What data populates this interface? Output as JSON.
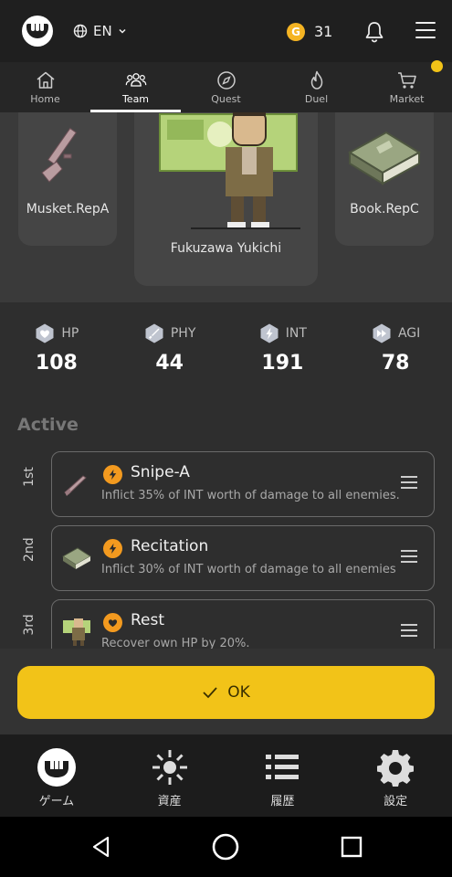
{
  "header": {
    "language": "EN",
    "coins": "31"
  },
  "nav_tabs": [
    {
      "label": "Home",
      "icon": "home-icon"
    },
    {
      "label": "Team",
      "icon": "team-icon",
      "active": true
    },
    {
      "label": "Quest",
      "icon": "compass-icon"
    },
    {
      "label": "Duel",
      "icon": "flame-icon"
    },
    {
      "label": "Market",
      "icon": "cart-icon"
    }
  ],
  "carousel": {
    "left": {
      "label": "Musket.RepA"
    },
    "center": {
      "label": "Fukuzawa Yukichi"
    },
    "right": {
      "label": "Book.RepC"
    }
  },
  "stats": [
    {
      "label": "HP",
      "value": "108"
    },
    {
      "label": "PHY",
      "value": "44"
    },
    {
      "label": "INT",
      "value": "191"
    },
    {
      "label": "AGI",
      "value": "78"
    }
  ],
  "active": {
    "title": "Active",
    "slots": [
      {
        "rank": "1st",
        "name": "Snipe-A",
        "desc": "Inflict 35% of INT worth of damage to all enemies.",
        "type": "lightning"
      },
      {
        "rank": "2nd",
        "name": "Recitation",
        "desc": "Inflict 30% of INT worth of damage to all enemies",
        "type": "lightning"
      },
      {
        "rank": "3rd",
        "name": "Rest",
        "desc": "Recover own HP by 20%.",
        "type": "heart"
      }
    ]
  },
  "ok_label": "OK",
  "bottom_nav": [
    {
      "label": "ゲーム",
      "icon": "game-logo-icon"
    },
    {
      "label": "資産",
      "icon": "asset-icon"
    },
    {
      "label": "履歴",
      "icon": "history-list-icon"
    },
    {
      "label": "設定",
      "icon": "settings-gear-icon"
    }
  ],
  "colors": {
    "accent": "#f2c318",
    "skill_badge": "#f39a1f",
    "background": "#2e2e2e"
  }
}
